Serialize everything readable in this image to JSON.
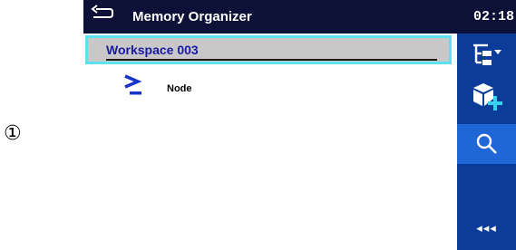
{
  "callout": "①",
  "header": {
    "title": "Memory Organizer",
    "clock": "02:18"
  },
  "workspace": {
    "label": "Workspace 003"
  },
  "node": {
    "label": "Node"
  },
  "sidebar": {
    "more_label": "◂◂◂",
    "icons": [
      "tree-view-icon",
      "add-object-icon",
      "search-icon",
      "more-icon"
    ]
  },
  "colors": {
    "titlebar": "#0d1137",
    "sidebar": "#0c3c99",
    "sidebar_active": "#1f66d6",
    "selection_border": "#5fe0f0",
    "selection_fill": "#c8c8c8",
    "workspace_text": "#1a1aa0"
  }
}
